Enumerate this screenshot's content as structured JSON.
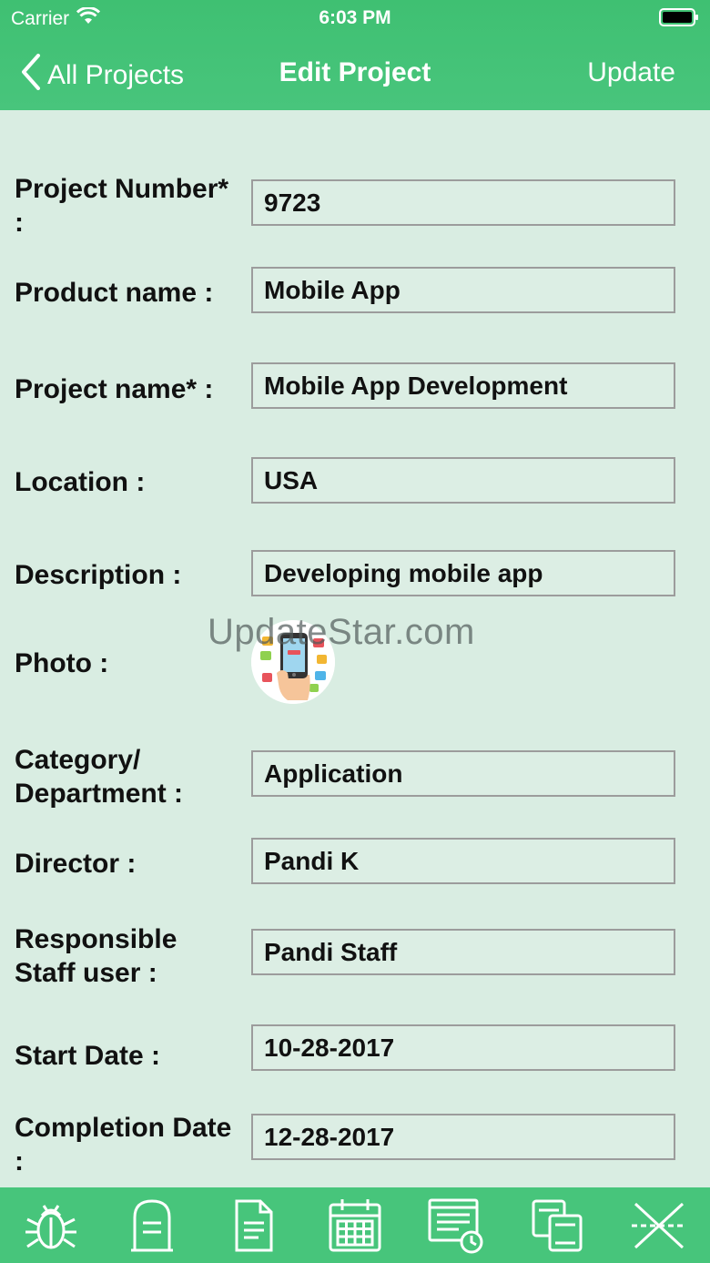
{
  "status_bar": {
    "carrier": "Carrier",
    "time": "6:03 PM"
  },
  "nav": {
    "back_label": "All Projects",
    "title": "Edit Project",
    "update_label": "Update"
  },
  "form": {
    "project_number": {
      "label": "Project Number* :",
      "value": "9723"
    },
    "product_name": {
      "label": "Product name :",
      "value": "Mobile App"
    },
    "project_name": {
      "label": "Project name* :",
      "value": "Mobile App Development"
    },
    "location": {
      "label": "Location :",
      "value": "USA"
    },
    "description": {
      "label": "Description :",
      "value": "Developing mobile app"
    },
    "photo": {
      "label": "Photo :"
    },
    "category": {
      "label": "Category/ Department :",
      "value": "Application"
    },
    "director": {
      "label": "Director :",
      "value": "Pandi K"
    },
    "staff": {
      "label": "Responsible Staff user :",
      "value": "Pandi Staff"
    },
    "start_date": {
      "label": "Start Date :",
      "value": "10-28-2017"
    },
    "completion_date": {
      "label": "Completion Date :",
      "value": "12-28-2017"
    }
  },
  "watermark": "UpdateStar.com",
  "tabbar": {
    "icons": [
      "bug-icon",
      "mailbox-icon",
      "document-icon",
      "calendar-icon",
      "report-clock-icon",
      "copy-icon",
      "cancel-icon"
    ]
  },
  "colors": {
    "header_bg": "#45c47a",
    "page_bg": "#d9ede2",
    "tabbar_bg": "#47c57b"
  }
}
